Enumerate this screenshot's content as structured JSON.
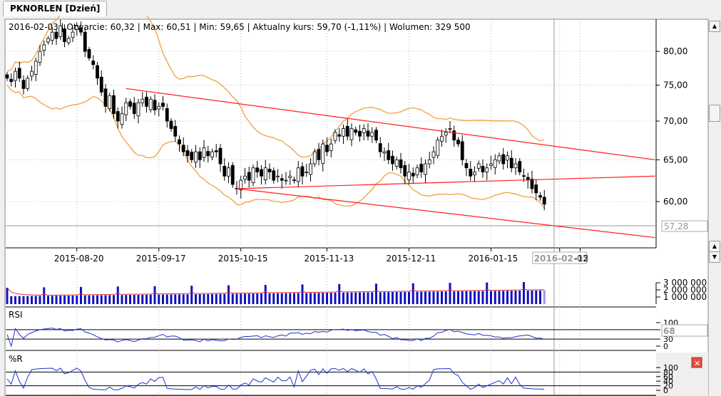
{
  "tab": {
    "label": "PKNORLEN [Dzień]"
  },
  "info_bar": "2016-02-03 | Otwarcie: 60,32 | Max: 60,51 | Min: 59,65 | Aktualny kurs: 59,70 (-1,11%)  | Wolumen: 329 500",
  "price_axis": {
    "labels": [
      "80,00",
      "75,00",
      "70,00",
      "65,00",
      "60,00"
    ],
    "values": [
      80,
      75,
      70,
      65,
      60
    ],
    "scale": "log",
    "marker": "57,28",
    "marker_value": 57.28
  },
  "date_axis": {
    "labels": [
      "2015-08-20",
      "2015-09-17",
      "2015-10-15",
      "2015-11-13",
      "2015-12-11",
      "2016-01-15",
      "2016-02-05",
      "-12"
    ],
    "indices": [
      17,
      37,
      57,
      78,
      98,
      118,
      133,
      138
    ],
    "cursor_label": "2016-02-05"
  },
  "volume_axis": {
    "labels": [
      "3 000 000",
      "2 000 000",
      "1 000 000"
    ]
  },
  "rsi": {
    "title": "RSI",
    "labels": [
      "100",
      "70",
      "30",
      "0"
    ],
    "readout": "68"
  },
  "wr": {
    "title": "%R",
    "labels": [
      "100",
      "80",
      "60",
      "40",
      "20",
      "0"
    ]
  },
  "colors": {
    "trendline": "#ff2020",
    "bollinger": "#f0a040",
    "volume": "#1010c0",
    "indicator": "#2030d0"
  },
  "chart_data": {
    "type": "candlestick",
    "last_date": "2016-02-03",
    "closes": [
      76,
      75.5,
      77,
      76,
      74.5,
      76,
      77,
      78.5,
      80,
      81,
      82,
      83,
      82,
      84,
      81.5,
      82,
      83,
      84,
      83,
      80,
      79,
      78,
      76,
      74,
      72,
      73.5,
      71,
      70,
      71,
      72.5,
      72,
      71,
      72.5,
      73,
      72,
      73,
      71.5,
      72,
      72,
      70,
      69,
      68,
      67,
      66,
      65.5,
      65,
      66,
      65,
      66.5,
      65.5,
      66,
      66,
      64.5,
      63,
      64,
      62,
      61.5,
      62.5,
      63,
      62.5,
      64,
      63.5,
      63,
      64,
      63.5,
      62.5,
      63,
      62.5,
      62.5,
      63,
      62.5,
      64,
      63,
      63.5,
      64.5,
      66,
      65,
      67,
      66,
      67,
      68.5,
      68,
      69,
      68,
      69,
      68.5,
      68,
      69,
      68,
      68.5,
      67.5,
      66,
      66,
      65,
      64.5,
      65,
      64,
      63,
      63.5,
      63,
      64,
      63.5,
      64.5,
      65,
      66,
      67.5,
      68,
      68.5,
      69,
      67.5,
      67,
      65,
      64,
      63,
      63.5,
      64.5,
      63.5,
      64,
      64.5,
      65,
      65.5,
      64.5,
      65.5,
      64,
      64.5,
      63.5,
      63,
      62.5,
      61.5,
      61,
      60.5,
      59.7
    ],
    "trendlines": [
      {
        "from": [
          29,
          74.5
        ],
        "to": [
          158,
          65
        ]
      },
      {
        "from": [
          56,
          61.5
        ],
        "to": [
          158,
          63
        ]
      },
      {
        "from": [
          56,
          61.5
        ],
        "to": [
          158,
          56
        ]
      }
    ]
  }
}
